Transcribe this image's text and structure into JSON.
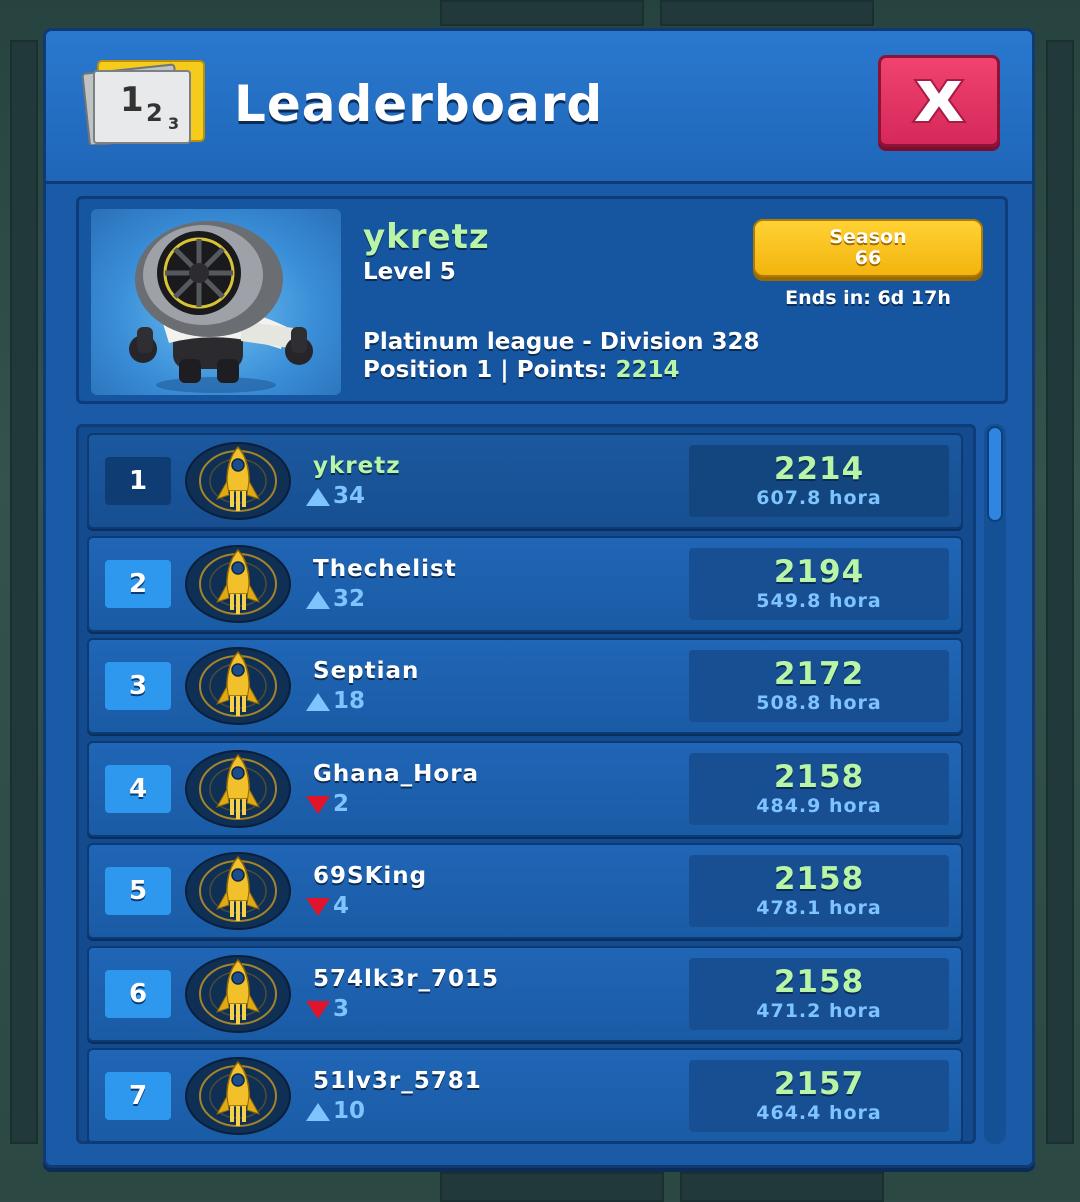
{
  "header": {
    "title": "Leaderboard",
    "trophy_icon": "podium-123-icon",
    "close_icon": "close-x-icon"
  },
  "profile": {
    "name": "ykretz",
    "level": "Level 5",
    "league": "Platinum league - Division 328",
    "position_text": "Position 1 | Points: ",
    "points": "2214",
    "season_label": "Season",
    "season_number": "66",
    "ends_in": "Ends in: 6d 17h",
    "avatar": "turbine-robot-avatar"
  },
  "colors": {
    "panel": "#1a5aa6",
    "accent_green": "#b9f5a6",
    "close_red": "#e23462",
    "season_gold": "#f8c21c",
    "rank_blue": "#2e98ee"
  },
  "rows": [
    {
      "rank": "1",
      "name": "ykretz",
      "trend": "up",
      "change": "34",
      "score": "2214",
      "hours": "607.8 hora"
    },
    {
      "rank": "2",
      "name": "Thechelist",
      "trend": "up",
      "change": "32",
      "score": "2194",
      "hours": "549.8 hora"
    },
    {
      "rank": "3",
      "name": "Septian",
      "trend": "up",
      "change": "18",
      "score": "2172",
      "hours": "508.8 hora"
    },
    {
      "rank": "4",
      "name": "Ghana_Hora",
      "trend": "down",
      "change": "2",
      "score": "2158",
      "hours": "484.9 hora"
    },
    {
      "rank": "5",
      "name": "69SKing",
      "trend": "down",
      "change": "4",
      "score": "2158",
      "hours": "478.1 hora"
    },
    {
      "rank": "6",
      "name": "574lk3r_7015",
      "trend": "down",
      "change": "3",
      "score": "2158",
      "hours": "471.2 hora"
    },
    {
      "rank": "7",
      "name": "51lv3r_5781",
      "trend": "up",
      "change": "10",
      "score": "2157",
      "hours": "464.4 hora"
    }
  ]
}
